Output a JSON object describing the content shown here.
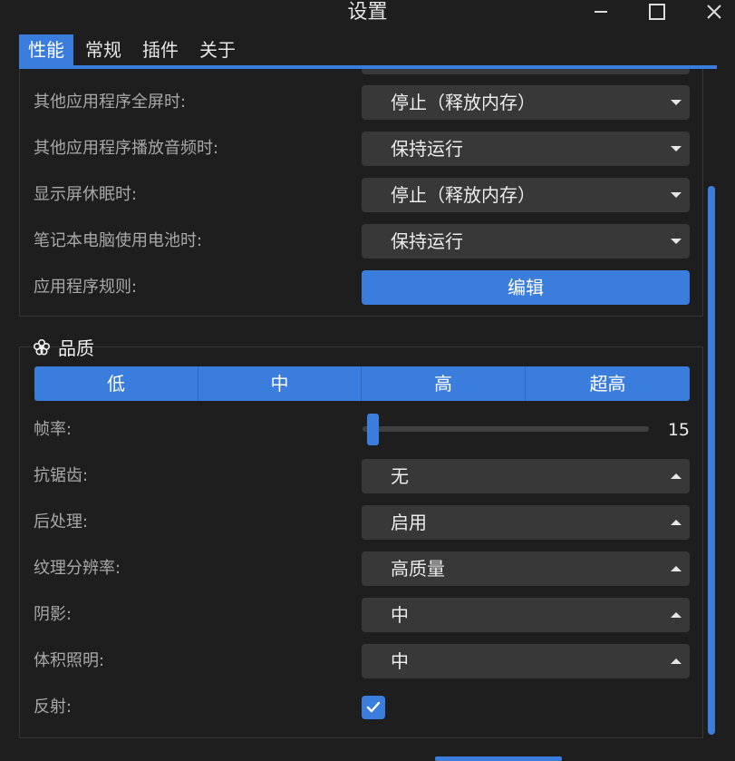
{
  "window": {
    "title": "设置",
    "controls": [
      "minimize-icon",
      "maximize-icon",
      "close-icon"
    ]
  },
  "tabs": [
    {
      "label": "性能",
      "active": true
    },
    {
      "label": "常规",
      "active": false
    },
    {
      "label": "插件",
      "active": false
    },
    {
      "label": "关于",
      "active": false
    }
  ],
  "performance": {
    "rows": [
      {
        "label": "其他应用程序全屏时:",
        "value": "停止（释放内存）"
      },
      {
        "label": "其他应用程序播放音频时:",
        "value": "保持运行"
      },
      {
        "label": "显示屏休眠时:",
        "value": "停止（释放内存）"
      },
      {
        "label": "笔记本电脑使用电池时:",
        "value": "保持运行"
      }
    ],
    "rules_label": "应用程序规则:",
    "edit_button": "编辑"
  },
  "quality": {
    "title": "品质",
    "icon": "gear-flower-icon",
    "presets": [
      "低",
      "中",
      "高",
      "超高"
    ],
    "framerate": {
      "label": "帧率:",
      "value": "15",
      "level": 0.03
    },
    "rows": [
      {
        "label": "抗锯齿:",
        "value": "无"
      },
      {
        "label": "后处理:",
        "value": "启用"
      },
      {
        "label": "纹理分辨率:",
        "value": "高质量"
      },
      {
        "label": "阴影:",
        "value": "中"
      },
      {
        "label": "体积照明:",
        "value": "中"
      }
    ],
    "reflection": {
      "label": "反射:",
      "checked": true
    }
  },
  "colors": {
    "accent": "#3b7ddd",
    "background": "#1e1e1e",
    "control": "#383838"
  }
}
